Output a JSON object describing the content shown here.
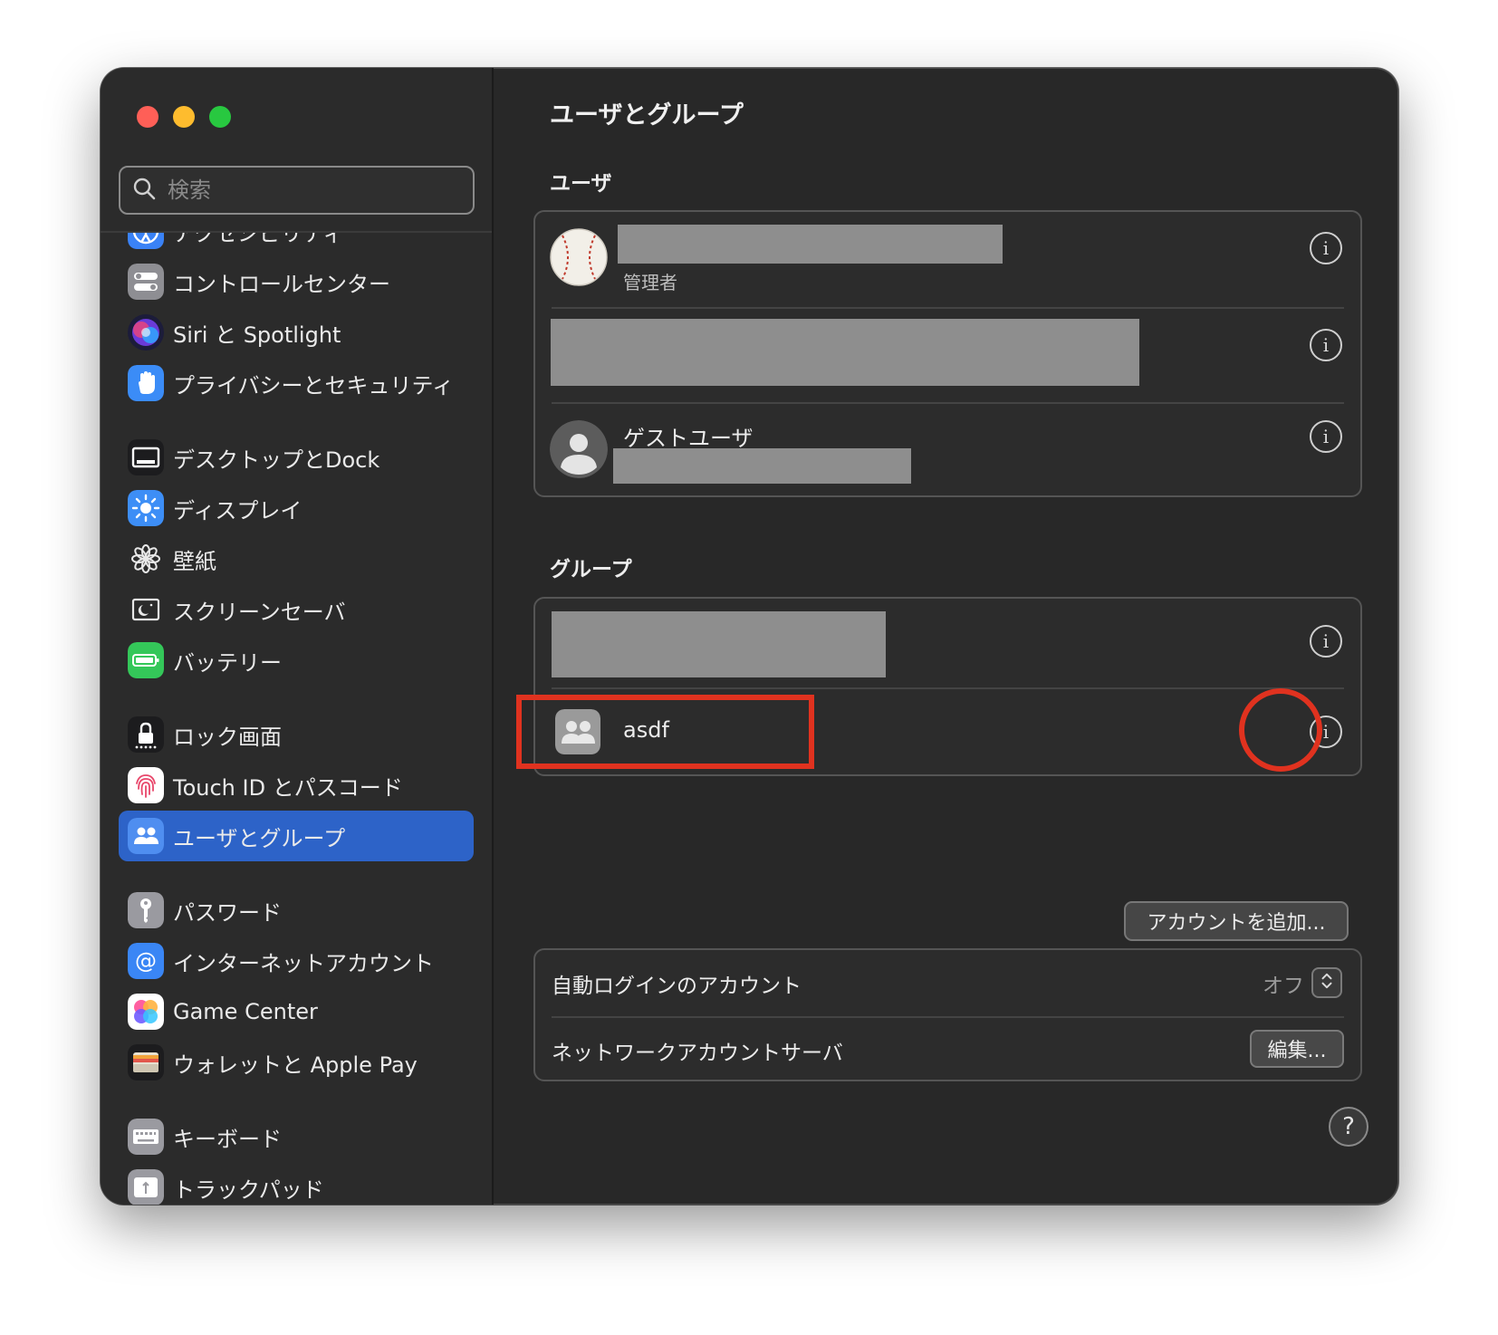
{
  "window": {
    "title": "ユーザとグループ"
  },
  "search": {
    "placeholder": "検索",
    "value": ""
  },
  "sidebar": {
    "items": [
      {
        "label": "アクセシビリティ",
        "icon": "accessibility-icon"
      },
      {
        "label": "コントロールセンター",
        "icon": "control-center-icon"
      },
      {
        "label": "Siri と Spotlight",
        "icon": "siri-icon"
      },
      {
        "label": "プライバシーとセキュリティ",
        "icon": "hand-icon"
      },
      {
        "label": "デスクトップとDock",
        "icon": "dock-icon"
      },
      {
        "label": "ディスプレイ",
        "icon": "display-brightness-icon"
      },
      {
        "label": "壁紙",
        "icon": "wallpaper-flower-icon"
      },
      {
        "label": "スクリーンセーバ",
        "icon": "screensaver-icon"
      },
      {
        "label": "バッテリー",
        "icon": "battery-icon"
      },
      {
        "label": "ロック画面",
        "icon": "lock-icon"
      },
      {
        "label": "Touch ID とパスコード",
        "icon": "fingerprint-icon"
      },
      {
        "label": "ユーザとグループ",
        "icon": "users-icon",
        "selected": true
      },
      {
        "label": "パスワード",
        "icon": "key-icon"
      },
      {
        "label": "インターネットアカウント",
        "icon": "at-icon"
      },
      {
        "label": "Game Center",
        "icon": "game-center-icon"
      },
      {
        "label": "ウォレットと Apple Pay",
        "icon": "wallet-icon"
      },
      {
        "label": "キーボード",
        "icon": "keyboard-icon"
      },
      {
        "label": "トラックパッド",
        "icon": "trackpad-icon"
      }
    ]
  },
  "main": {
    "title": "ユーザとグループ",
    "users_section": {
      "title": "ユーザ",
      "rows": [
        {
          "role": "管理者",
          "redacted": true
        },
        {
          "redacted": true
        },
        {
          "name": "ゲストユーザ",
          "redacted": true
        }
      ]
    },
    "groups_section": {
      "title": "グループ",
      "rows": [
        {
          "redacted": true
        },
        {
          "name": "asdf"
        }
      ]
    },
    "add_account_label": "アカウントを追加...",
    "options": {
      "auto_login_label": "自動ログインのアカウント",
      "auto_login_value": "オフ",
      "network_server_label": "ネットワークアカウントサーバ",
      "edit_label": "編集..."
    },
    "help_label": "?"
  },
  "colors": {
    "accent": "#2d63c8",
    "annotation": "#e0321f",
    "window_bg": "#282828",
    "close": "#ff5f57",
    "minimize": "#febc2e",
    "zoom": "#28c840"
  }
}
